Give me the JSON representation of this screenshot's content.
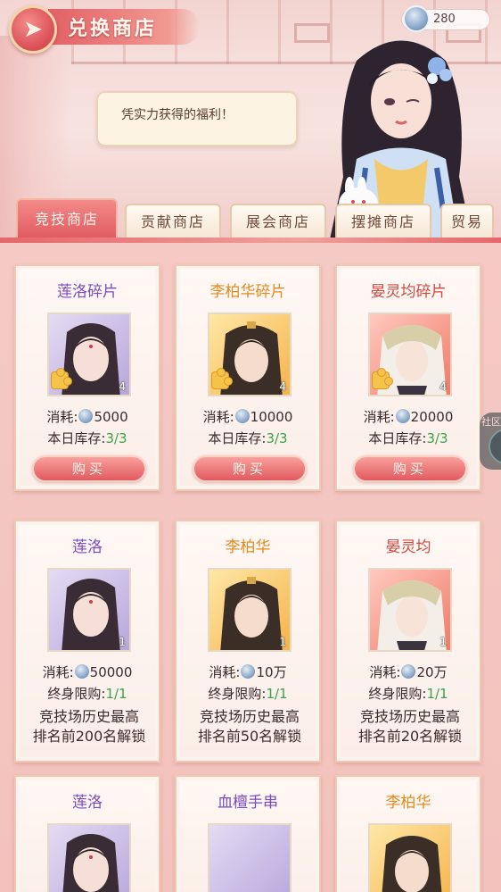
{
  "header": {
    "title": "兑换商店",
    "currency_value": "280",
    "speech": "凭实力获得的福利！"
  },
  "tabs": [
    {
      "label": "竞技商店",
      "active": true
    },
    {
      "label": "贡献商店",
      "active": false
    },
    {
      "label": "展会商店",
      "active": false
    },
    {
      "label": "摆摊商店",
      "active": false
    },
    {
      "label": "贸易",
      "active": false
    }
  ],
  "labels": {
    "cost": "消耗:",
    "daily_stock": "本日库存:",
    "lifetime_limit": "终身限购:",
    "buy": "购买"
  },
  "items_row1": [
    {
      "name": "莲洛碎片",
      "rarity": "purple",
      "qty": "4",
      "cost": "5000",
      "stock": "3/3"
    },
    {
      "name": "李柏华碎片",
      "rarity": "orange",
      "qty": "4",
      "cost": "10000",
      "stock": "3/3"
    },
    {
      "name": "晏灵均碎片",
      "rarity": "red",
      "qty": "4",
      "cost": "20000",
      "stock": "3/3"
    }
  ],
  "items_row2": [
    {
      "name": "莲洛",
      "rarity": "purple",
      "qty": "1",
      "cost": "50000",
      "limit": "1/1",
      "unlock_1": "竞技场历史最高",
      "unlock_2": "排名前200名解锁"
    },
    {
      "name": "李柏华",
      "rarity": "orange",
      "qty": "1",
      "cost": "10万",
      "limit": "1/1",
      "unlock_1": "竞技场历史最高",
      "unlock_2": "排名前50名解锁"
    },
    {
      "name": "晏灵均",
      "rarity": "red",
      "qty": "1",
      "cost": "20万",
      "limit": "1/1",
      "unlock_1": "竞技场历史最高",
      "unlock_2": "排名前20名解锁"
    }
  ],
  "items_row3": [
    {
      "name": "莲洛",
      "rarity": "purple"
    },
    {
      "name": "血檀手串",
      "rarity": "purple"
    },
    {
      "name": "李柏华",
      "rarity": "orange"
    }
  ],
  "side": {
    "label": "社区"
  },
  "colors": {
    "accent": "#e05a60",
    "purple": "#7a4bc0",
    "orange": "#e48a1f",
    "red": "#d4473f",
    "green": "#3aa24a"
  }
}
